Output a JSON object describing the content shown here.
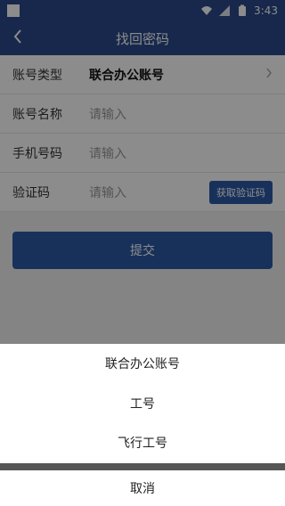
{
  "status_bar": {
    "time": "3:43"
  },
  "app_bar": {
    "back_icon": "chevron-left-icon",
    "title": "找回密码"
  },
  "form": {
    "rows": [
      {
        "label": "账号类型",
        "value": "联合办公账号"
      },
      {
        "label": "账号名称",
        "placeholder": "请输入"
      },
      {
        "label": "手机号码",
        "placeholder": "请输入"
      },
      {
        "label": "验证码",
        "placeholder": "请输入",
        "button": "获取验证码"
      }
    ],
    "submit_label": "提交"
  },
  "sheet": {
    "options": [
      "联合办公账号",
      "工号",
      "飞行工号"
    ],
    "cancel_label": "取消"
  },
  "colors": {
    "primary": "#2a4a8a",
    "button": "#2d5aa6"
  }
}
